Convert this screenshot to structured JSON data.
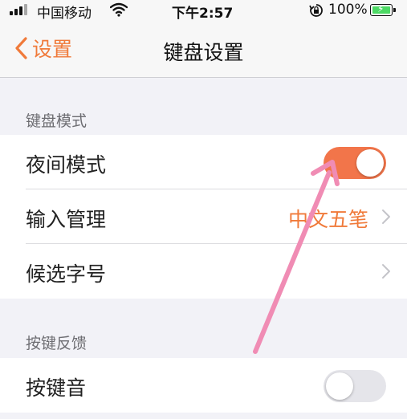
{
  "status_bar": {
    "carrier": "中国移动",
    "time": "下午2:57",
    "battery_percent": "100%",
    "icons": [
      "signal-icon",
      "wifi-icon",
      "rotation-lock-icon",
      "battery-charging-icon"
    ]
  },
  "nav": {
    "back_label": "设置",
    "title": "键盘设置"
  },
  "sections": {
    "keyboard_mode": {
      "header": "键盘模式",
      "rows": {
        "night_mode": {
          "label": "夜间模式",
          "toggle": "on"
        },
        "input_management": {
          "label": "输入管理",
          "value": "中文五笔"
        },
        "candidate_font_size": {
          "label": "候选字号"
        }
      }
    },
    "key_feedback": {
      "header": "按键反馈",
      "rows": {
        "key_sound": {
          "label": "按键音",
          "toggle": "off"
        }
      }
    }
  },
  "colors": {
    "accent": "#f07a3a",
    "toggle_on": "#f2754a",
    "annotation_arrow": "#f08cb4",
    "background": "#f2f2f7"
  }
}
